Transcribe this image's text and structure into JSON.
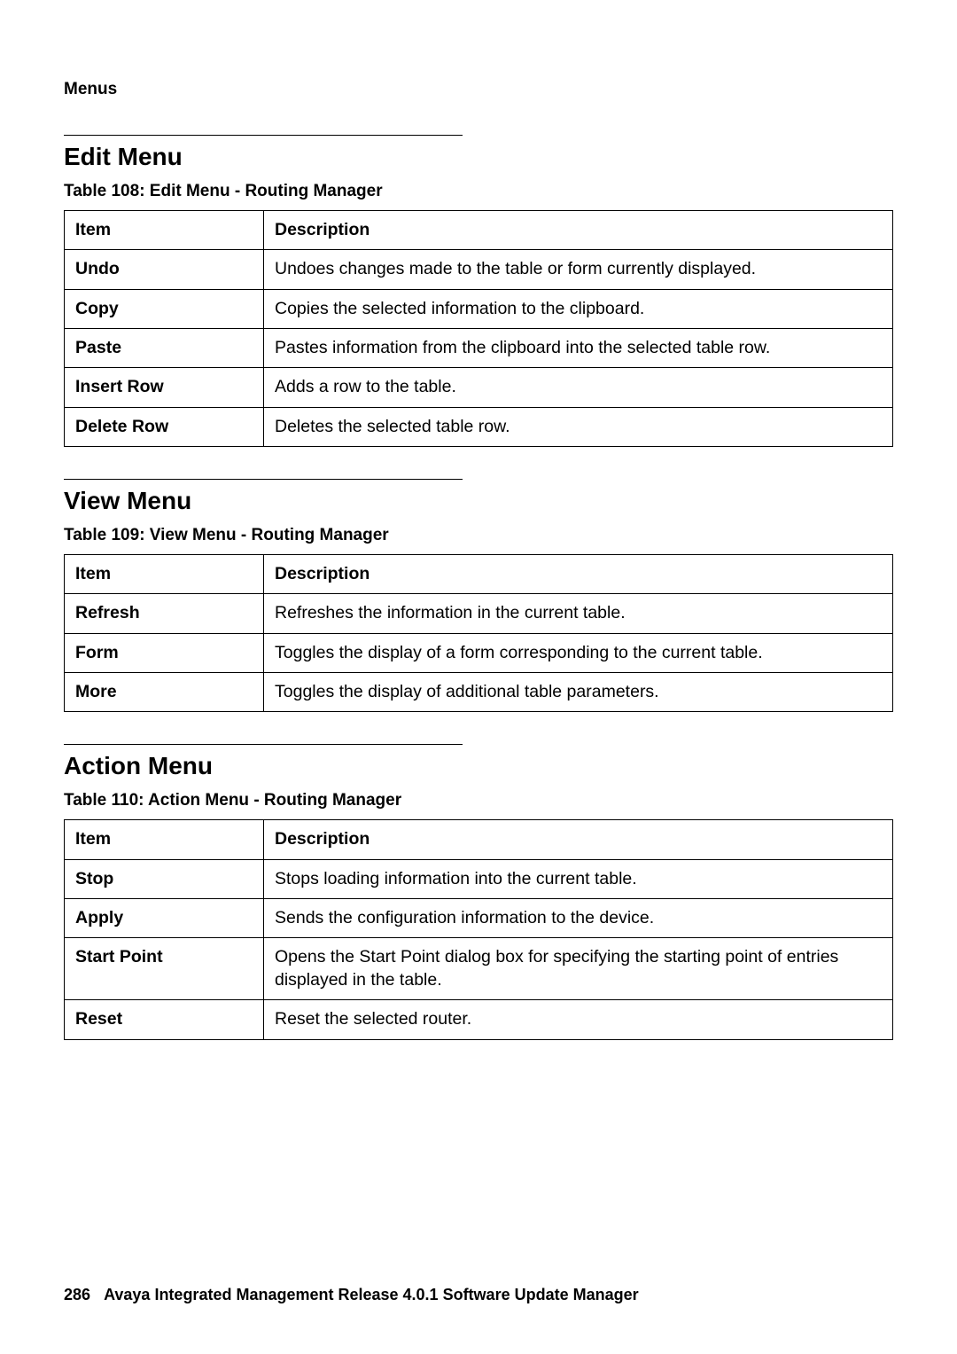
{
  "header": {
    "title": "Menus"
  },
  "sections": {
    "edit": {
      "heading": "Edit Menu",
      "caption": "Table 108: Edit Menu - Routing Manager",
      "columns": {
        "item": "Item",
        "description": "Description"
      },
      "rows": [
        {
          "item": "Undo",
          "desc": "Undoes changes made to the table or form currently displayed."
        },
        {
          "item": "Copy",
          "desc": "Copies the selected information to the clipboard."
        },
        {
          "item": "Paste",
          "desc": "Pastes information from the clipboard into the selected table row."
        },
        {
          "item": "Insert Row",
          "desc": "Adds a row to the table."
        },
        {
          "item": "Delete Row",
          "desc": "Deletes the selected table row."
        }
      ]
    },
    "view": {
      "heading": "View Menu",
      "caption": "Table 109: View Menu - Routing Manager",
      "columns": {
        "item": "Item",
        "description": "Description"
      },
      "rows": [
        {
          "item": "Refresh",
          "desc": "Refreshes the information in the current table."
        },
        {
          "item": "Form",
          "desc": "Toggles the display of a form corresponding to the current table."
        },
        {
          "item": "More",
          "desc": "Toggles the display of additional table parameters."
        }
      ]
    },
    "action": {
      "heading": "Action Menu",
      "caption": "Table 110: Action Menu - Routing Manager",
      "columns": {
        "item": "Item",
        "description": "Description"
      },
      "rows": [
        {
          "item": "Stop",
          "desc": "Stops loading information into the current table."
        },
        {
          "item": "Apply",
          "desc": "Sends the configuration information to the device."
        },
        {
          "item": "Start Point",
          "desc": "Opens the Start Point dialog box for specifying the starting point of entries displayed in the table."
        },
        {
          "item": "Reset",
          "desc": "Reset the selected router."
        }
      ]
    }
  },
  "footer": {
    "page_number": "286",
    "doc_title": "Avaya Integrated Management Release 4.0.1 Software Update Manager"
  }
}
